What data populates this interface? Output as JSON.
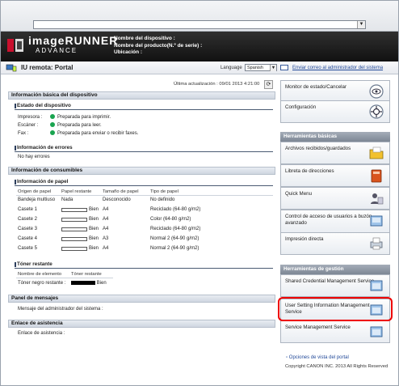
{
  "header": {
    "brand": "imageRUNNER",
    "sub": "ADVANCE",
    "device_name_label": "Nombre del dispositivo :",
    "product_name_label": "Nombre del producto(N.º de serie) :",
    "location_label": "Ubicación :"
  },
  "subbar": {
    "title": "IU remota: Portal",
    "language_label": "Language",
    "language_value": "Spanish",
    "mail_link": "Enviar correo al administrador del sistema"
  },
  "main": {
    "update_text": "Última actualización : 09/01 2013 4:21:00",
    "basic_info_title": "Información básica del dispositivo",
    "device_status_title": "Estado del dispositivo",
    "status": [
      {
        "label": "Impresora :",
        "value": "Preparada para imprimir."
      },
      {
        "label": "Escáner :",
        "value": "Preparada para leer."
      },
      {
        "label": "Fax :",
        "value": "Preparada para enviar o recibir faxes."
      }
    ],
    "errors_title": "Información de errores",
    "errors_value": "No hay errores",
    "consumables_title": "Información de consumibles",
    "paper_title": "Información de papel",
    "paper_headers": [
      "Origen de papel",
      "Papel restante",
      "Tamaño de papel",
      "Tipo de papel"
    ],
    "paper_rows": [
      {
        "source": "Bandeja multiuso",
        "remaining": "Nada",
        "size": "Desconocido",
        "type": "No definido",
        "bar": false
      },
      {
        "source": "Casete 1",
        "remaining": "Bien",
        "size": "A4",
        "type": "Reciclado (64-80 g/m2)",
        "bar": true
      },
      {
        "source": "Casete 2",
        "remaining": "Bien",
        "size": "A4",
        "type": "Color (64-80 g/m2)",
        "bar": true
      },
      {
        "source": "Casete 3",
        "remaining": "Bien",
        "size": "A4",
        "type": "Reciclado (64-80 g/m2)",
        "bar": true
      },
      {
        "source": "Casete 4",
        "remaining": "Bien",
        "size": "A3",
        "type": "Normal 2 (64-90 g/m2)",
        "bar": true
      },
      {
        "source": "Casete 5",
        "remaining": "Bien",
        "size": "A4",
        "type": "Normal 2 (64-90 g/m2)",
        "bar": true
      }
    ],
    "toner_title": "Tóner restante",
    "toner_headers": [
      "Nombre de elemento",
      "Tóner restante"
    ],
    "toner_row_label": "Tóner negro restante :",
    "toner_row_value": "Bien",
    "messages_title": "Panel de mensajes",
    "messages_label": "Mensaje del administrador del sistema :",
    "support_title": "Enlace de asistencia",
    "support_label": "Enlace de asistencia :"
  },
  "side": {
    "monitor": "Monitor de estado/Cancelar",
    "config": "Configuración",
    "basic_tools_title": "Herramientas básicas",
    "received_files": "Archivos recibidos/guardados",
    "address_book": "Libreta de direcciones",
    "quick_menu": "Quick Menu",
    "access_control": "Control de acceso de usuarios a buzón avanzado",
    "direct_print": "Impresión directa",
    "admin_tools_title": "Herramientas de gestión",
    "shared_credential": "Shared Credential Management Service",
    "user_setting": "User Setting Information Management Service",
    "service_mgmt": "Service Management Service",
    "portal_options": "Opciones de vista del portal",
    "copyright": "Copyright CANON INC. 2013 All Rights Reserved"
  }
}
